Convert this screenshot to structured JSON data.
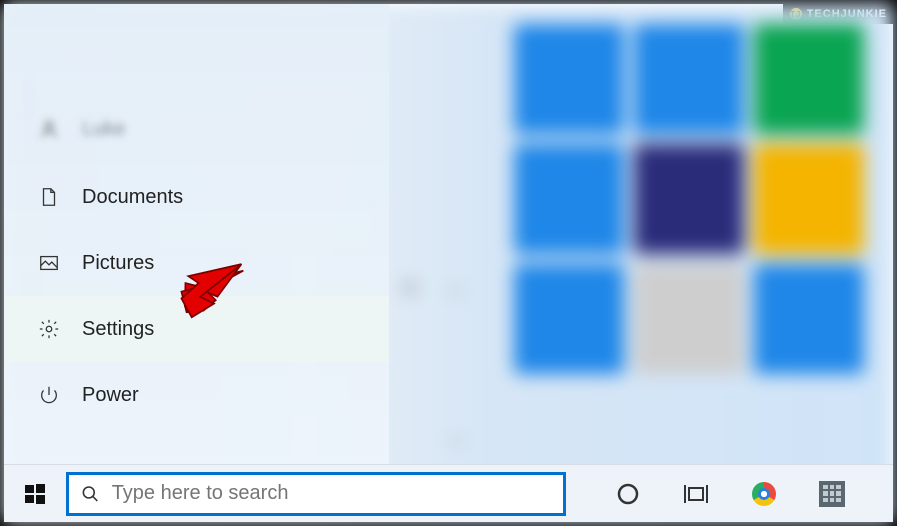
{
  "watermark": {
    "label": "TECHJUNKIE"
  },
  "sidebar": {
    "profile_label": "Luke",
    "documents_label": "Documents",
    "pictures_label": "Pictures",
    "settings_label": "Settings",
    "power_label": "Power"
  },
  "startmenu": {
    "expand_letter": "e"
  },
  "taskbar": {
    "search_placeholder": "Type here to search"
  }
}
